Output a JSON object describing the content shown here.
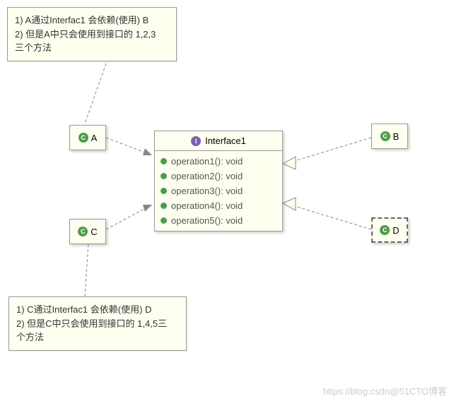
{
  "notes": {
    "top": {
      "line1": "1) A通过Interfac1 会依赖(使用) B",
      "line2": "2) 但是A中只会使用到接口的 1,2,3",
      "line3": "三个方法"
    },
    "bottom": {
      "line1": "1) C通过Interfac1 会依赖(使用) D",
      "line2": "2) 但是C中只会使用到接口的 1,4,5三",
      "line3": "个方法"
    }
  },
  "classes": {
    "a": {
      "label": "A",
      "icon": "C"
    },
    "b": {
      "label": "B",
      "icon": "C"
    },
    "c": {
      "label": "C",
      "icon": "C"
    },
    "d": {
      "label": "D",
      "icon": "C"
    }
  },
  "interface": {
    "icon": "I",
    "name": "Interface1",
    "operations": [
      "operation1(): void",
      "operation2(): void",
      "operation3(): void",
      "operation4(): void",
      "operation5(): void"
    ]
  },
  "watermark": "https://blog.csdn@51CTO博客"
}
